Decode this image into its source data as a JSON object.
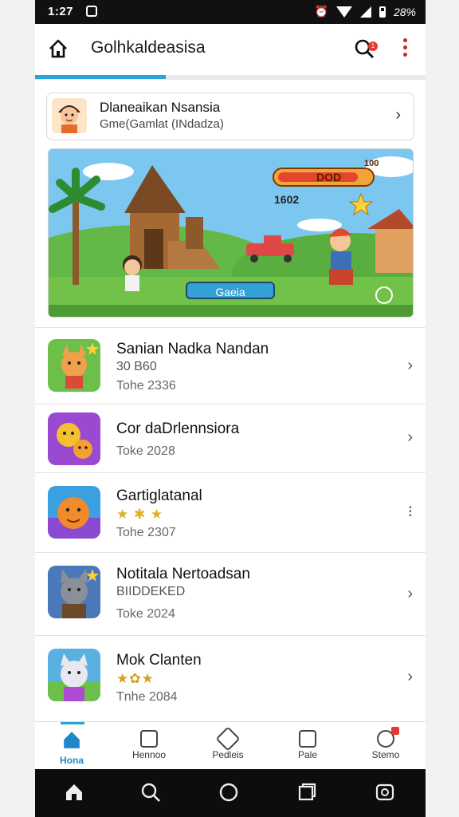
{
  "status": {
    "time": "1:27",
    "battery": "28%"
  },
  "appbar": {
    "title": "Golhkaldeasisa",
    "badge": "1"
  },
  "featured": {
    "line1": "Dlaneaikan Nsansia",
    "line2": "Gme(Gamlat (INdadza)"
  },
  "banner": {
    "score_label": "DOD",
    "score_num": "100",
    "counter": "1602",
    "play_label": "Gaeia"
  },
  "games": [
    {
      "name": "Sanian Nadka Nandan",
      "sub": "30 B60",
      "meta": "Tohe 2336"
    },
    {
      "name": "Cor daDrlennsiora",
      "meta": "Toke 2028"
    },
    {
      "name": "Gartiglatanal",
      "stars": "★ ✱ ★",
      "meta": "Tohe 2307"
    },
    {
      "name": "Notitala Nertoadsan",
      "sub": "BIIDDEKED",
      "meta": "Toke 2024"
    },
    {
      "name": "Mok Clanten",
      "stars": "★✿★",
      "meta": "Tnhe 2084"
    }
  ],
  "nav": [
    {
      "label": "Hona",
      "icon": "home-icon"
    },
    {
      "label": "Hennoo",
      "icon": "game-icon"
    },
    {
      "label": "Pedleis",
      "icon": "rocket-icon"
    },
    {
      "label": "Pale",
      "icon": "list-icon"
    },
    {
      "label": "Stemo",
      "icon": "profile-icon"
    }
  ],
  "colors": {
    "accent": "#29a3d9",
    "badge": "#e53935"
  }
}
